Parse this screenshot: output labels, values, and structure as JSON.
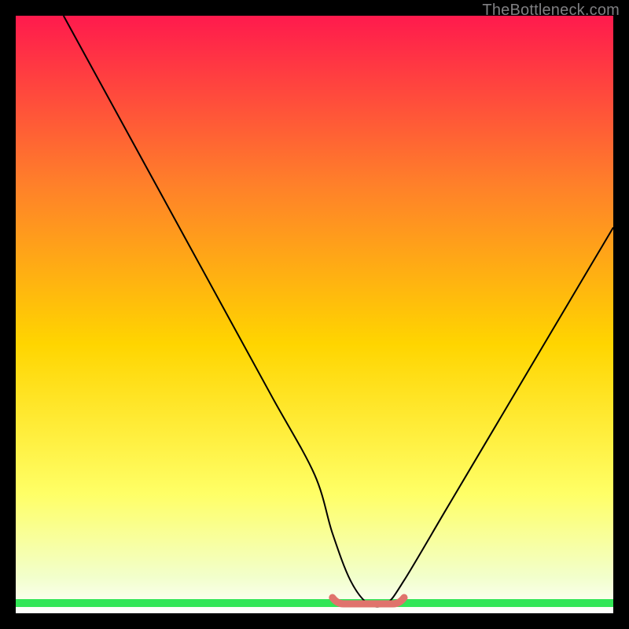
{
  "watermark": "TheBottleneck.com",
  "colors": {
    "frame": "#000000",
    "curve": "#000000",
    "bottom_highlight": "#e0736c",
    "green_band": "#32e656",
    "gradient_top": "#ff1a4d",
    "gradient_mid1": "#ff7f2a",
    "gradient_mid2": "#ffd500",
    "gradient_mid3": "#ffff66",
    "gradient_bottom_fade": "#f2ffcc"
  },
  "chart_data": {
    "type": "line",
    "title": "",
    "xlabel": "",
    "ylabel": "",
    "xlim": [
      0,
      100
    ],
    "ylim": [
      0,
      100
    ],
    "grid": false,
    "series": [
      {
        "name": "bottleneck-curve",
        "x": [
          8,
          15,
          22,
          29,
          36,
          43,
          50,
          53,
          56,
          59,
          62,
          65,
          72,
          79,
          86,
          93,
          100
        ],
        "y": [
          100,
          87,
          74,
          61,
          48,
          35,
          22,
          12,
          4,
          0,
          0,
          4,
          16,
          28,
          40,
          52,
          64
        ]
      }
    ],
    "annotations": [
      {
        "name": "bottom-highlight-segment",
        "x_range": [
          53,
          65
        ],
        "y": 0,
        "color_key": "bottom_highlight"
      }
    ]
  }
}
